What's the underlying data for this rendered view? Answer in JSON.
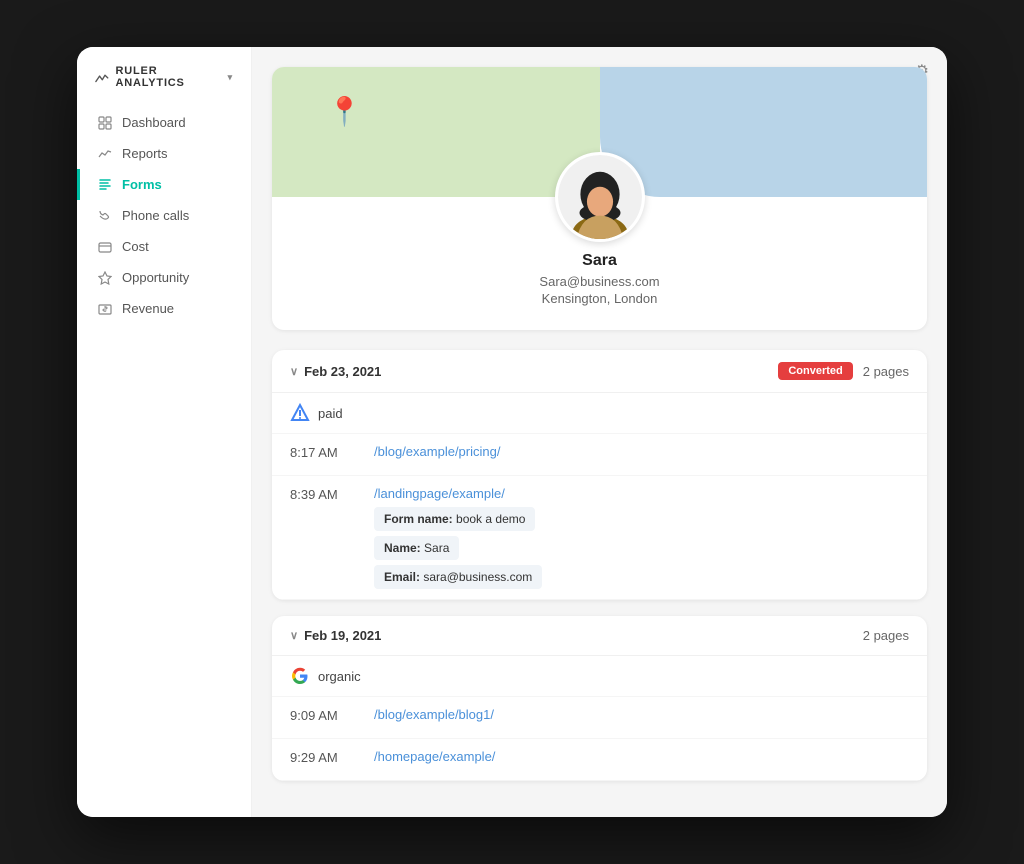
{
  "brand": {
    "logo_label": "RULER ANALYTICS",
    "chevron": "▾"
  },
  "nav": {
    "items": [
      {
        "id": "dashboard",
        "label": "Dashboard",
        "active": false
      },
      {
        "id": "reports",
        "label": "Reports",
        "active": false
      },
      {
        "id": "forms",
        "label": "Forms",
        "active": true
      },
      {
        "id": "phone-calls",
        "label": "Phone calls",
        "active": false
      },
      {
        "id": "cost",
        "label": "Cost",
        "active": false
      },
      {
        "id": "opportunity",
        "label": "Opportunity",
        "active": false
      },
      {
        "id": "revenue",
        "label": "Revenue",
        "active": false
      }
    ]
  },
  "profile": {
    "name": "Sara",
    "email": "Sara@business.com",
    "location": "Kensington, London"
  },
  "sessions": [
    {
      "id": "session-1",
      "date": "Feb 23, 2021",
      "converted": true,
      "converted_label": "Converted",
      "pages": "2 pages",
      "source": "paid",
      "source_type": "google-ads",
      "visits": [
        {
          "time": "8:17 AM",
          "url": "/blog/example/pricing/",
          "form": null
        },
        {
          "time": "8:39 AM",
          "url": "/landingpage/example/",
          "form": {
            "form_name_label": "Form name:",
            "form_name_value": "book a demo",
            "name_label": "Name:",
            "name_value": "Sara",
            "email_label": "Email:",
            "email_value": "sara@business.com"
          }
        }
      ]
    },
    {
      "id": "session-2",
      "date": "Feb 19, 2021",
      "converted": false,
      "converted_label": "",
      "pages": "2 pages",
      "source": "organic",
      "source_type": "google-organic",
      "visits": [
        {
          "time": "9:09 AM",
          "url": "/blog/example/blog1/",
          "form": null
        },
        {
          "time": "9:29 AM",
          "url": "/homepage/example/",
          "form": null
        }
      ]
    }
  ]
}
